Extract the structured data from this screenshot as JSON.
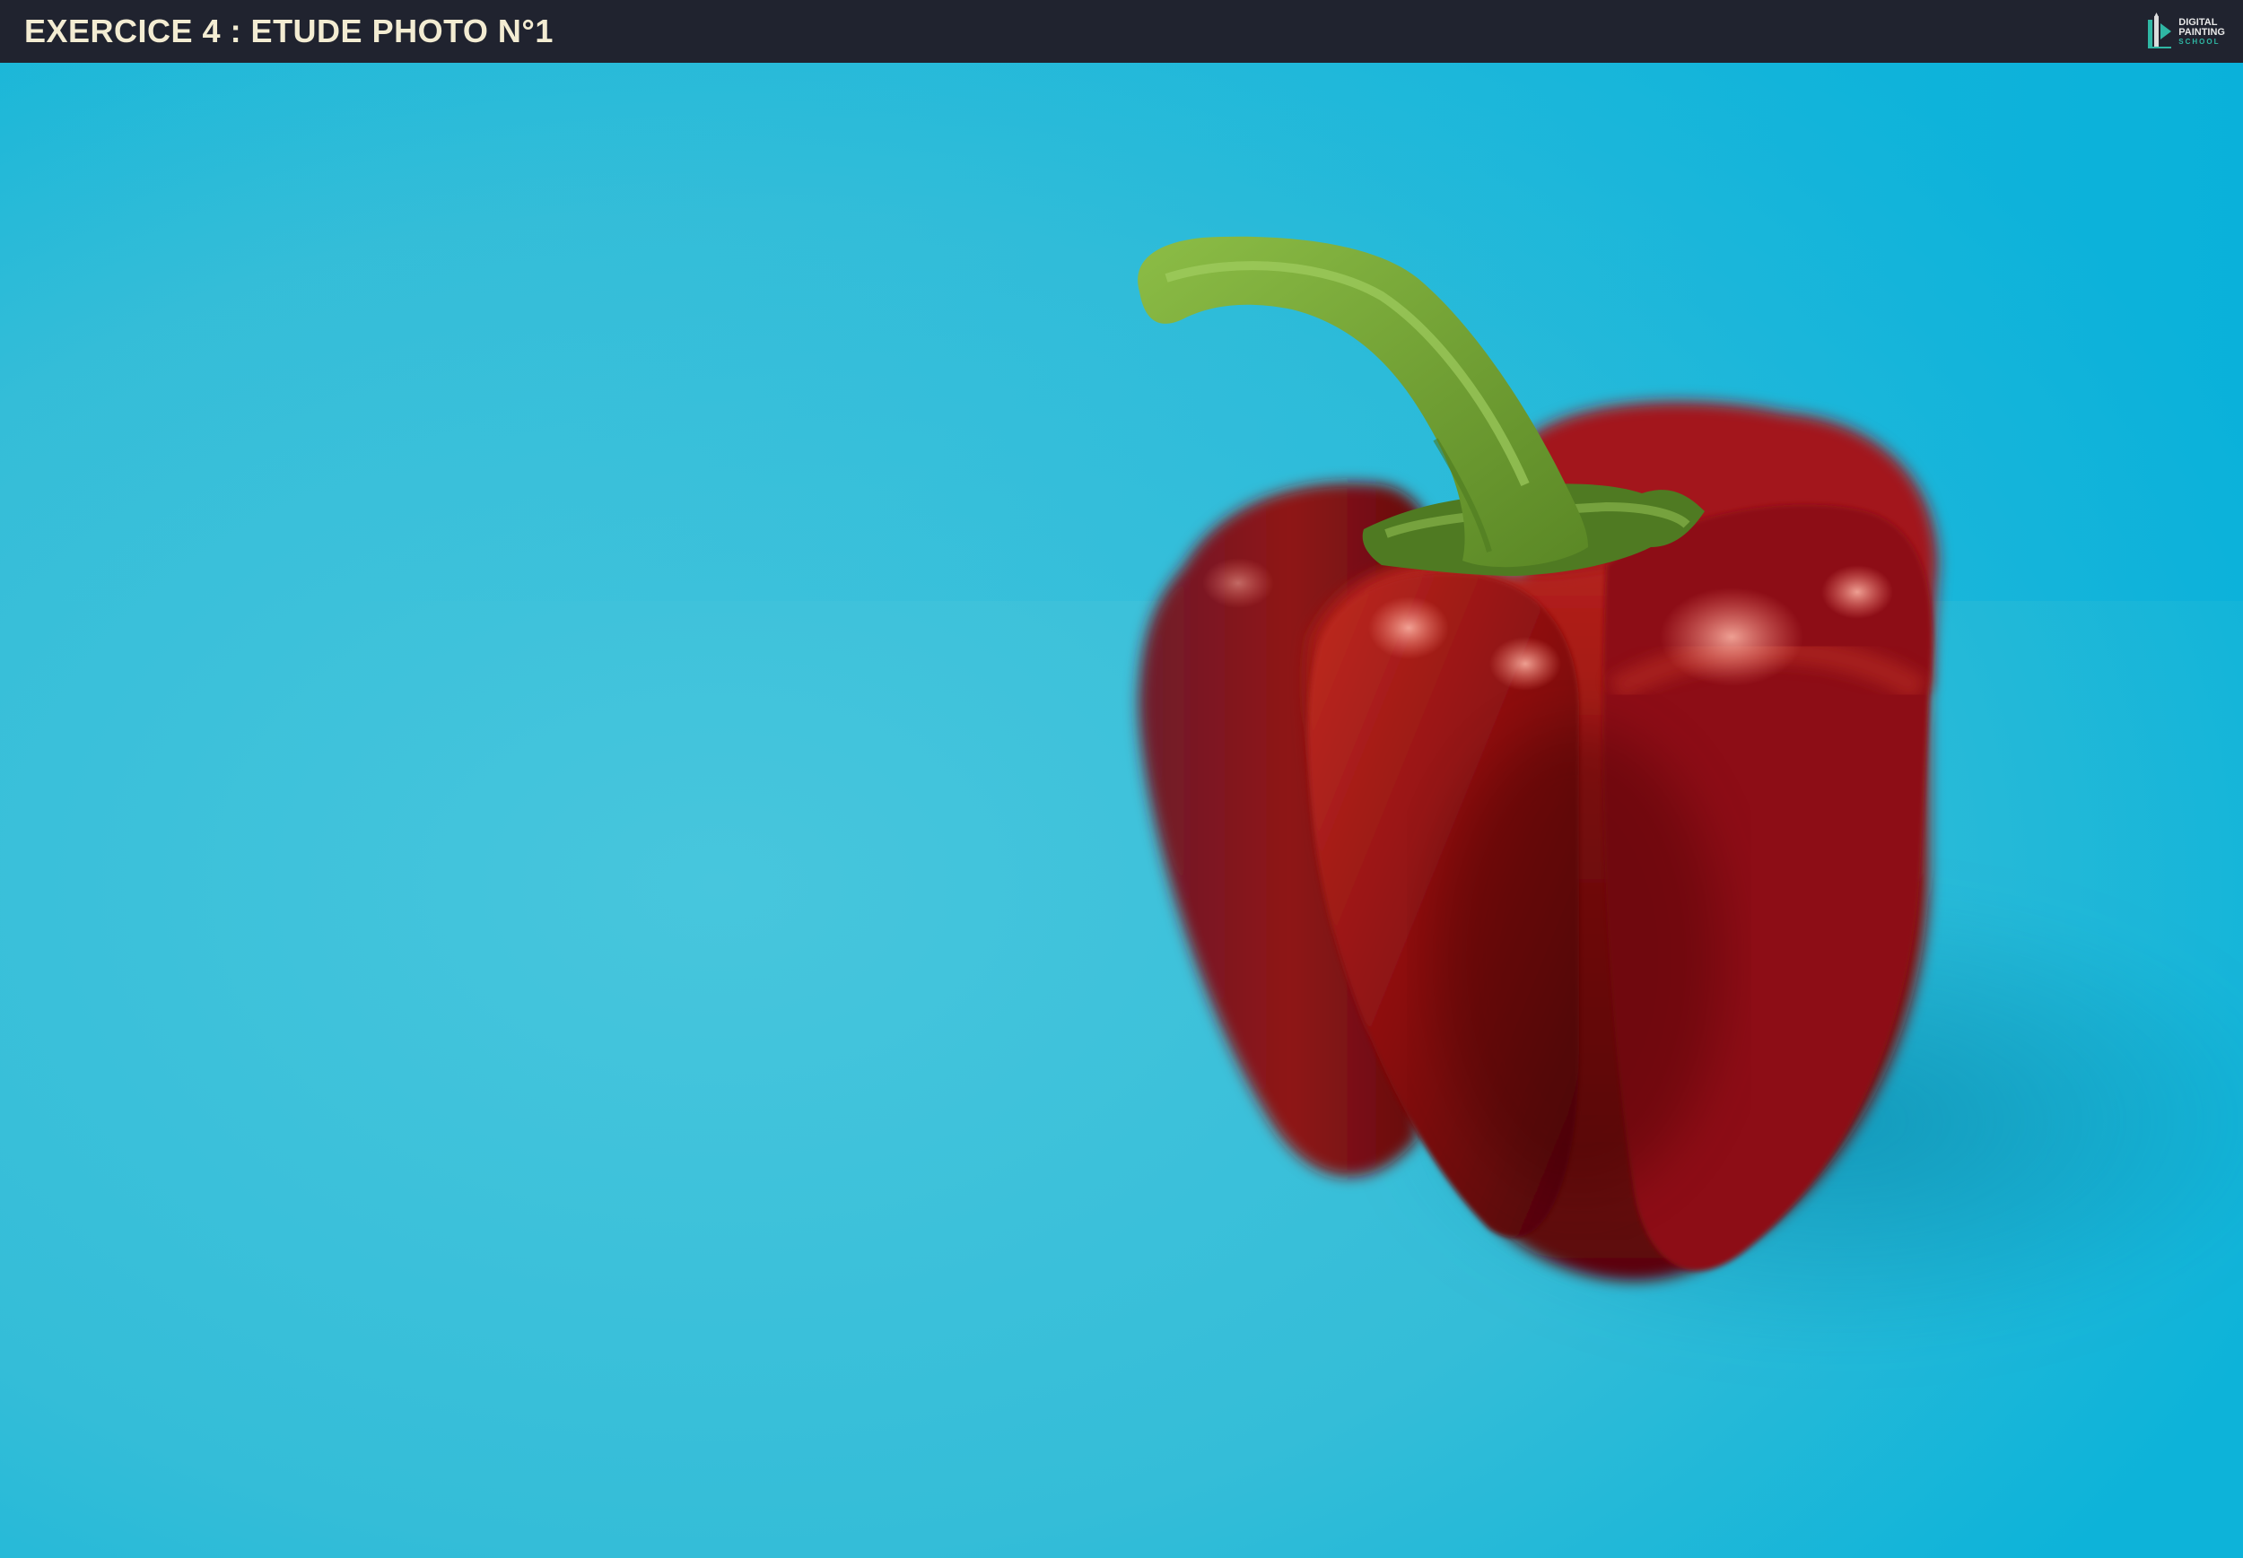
{
  "header": {
    "title": "EXERCICE 4 : ETUDE PHOTO N°1",
    "logo": {
      "line1": "DIGITAL",
      "line2": "PAINTING",
      "line3": "SCHOOL",
      "icon": "digital-painting-school-logo-icon"
    }
  },
  "colors": {
    "header_bg": "#20232f",
    "title": "#f3ecd2",
    "background": "#2ab8d6",
    "pepper": "#9e1414",
    "stem": "#6f9d2e",
    "logo_accent": "#2fb7a4"
  }
}
